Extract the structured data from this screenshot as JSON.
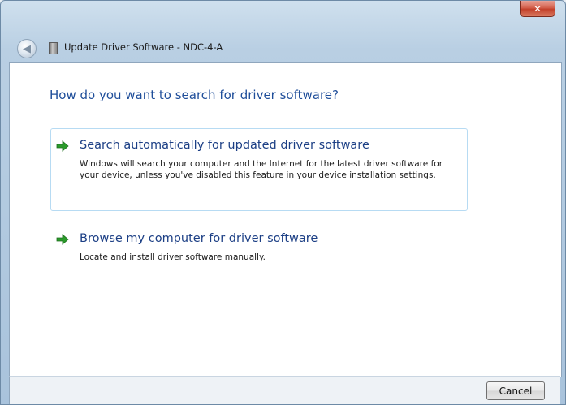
{
  "window": {
    "title": "Update Driver Software - NDC-4-A",
    "close_glyph": "✕",
    "back_glyph": "◀"
  },
  "content": {
    "heading": "How do you want to search for driver software?",
    "options": [
      {
        "title": "Search automatically for updated driver software",
        "description": "Windows will search your computer and the Internet for the latest driver software for your device, unless you've disabled this feature in your device installation settings.",
        "icon": "green-arrow-icon",
        "highlighted": true
      },
      {
        "title_first_letter": "B",
        "title_rest": "rowse my computer for driver software",
        "description": "Locate and install driver software manually.",
        "icon": "green-arrow-icon",
        "highlighted": false
      }
    ]
  },
  "footer": {
    "cancel_label": "Cancel"
  },
  "colors": {
    "heading": "#1f4e9a",
    "highlight_border": "#b7dbf3",
    "arrow_green": "#2a9a2a",
    "close_red": "#c2402a"
  }
}
